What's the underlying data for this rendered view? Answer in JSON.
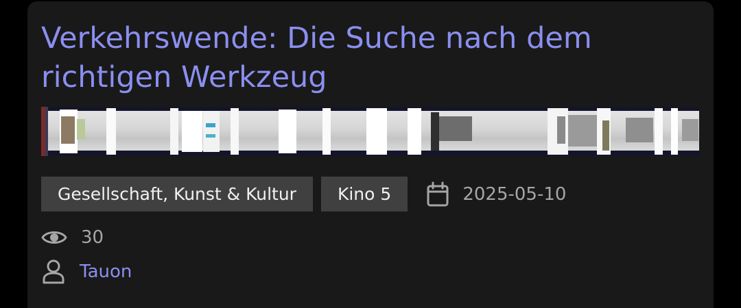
{
  "video": {
    "title": "Verkehrswende: Die Suche nach dem richtigen Werkzeug",
    "tags": [
      {
        "label": "Gesellschaft, Kunst & Kultur"
      },
      {
        "label": "Kino 5"
      }
    ],
    "date": "2025-05-10",
    "views": "30",
    "author": "Tauon"
  },
  "icons": {
    "date": "calendar-icon",
    "views": "eye-icon",
    "author": "user-icon"
  },
  "colors": {
    "accent": "#8b8ff0",
    "card_background": "#191919",
    "tag_background": "#404040",
    "muted_text": "#a6a6a6",
    "page_background": "#000000"
  }
}
